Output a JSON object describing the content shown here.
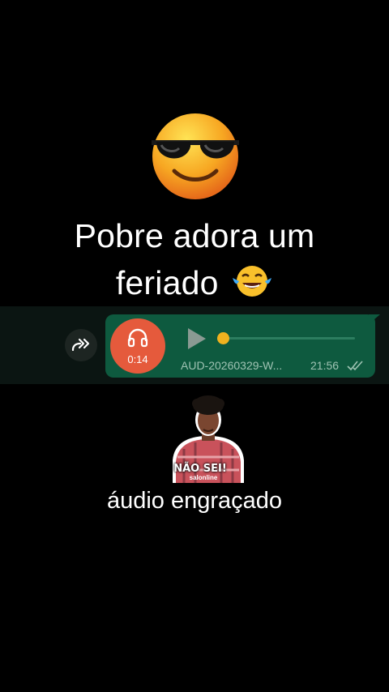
{
  "headline": {
    "line1": "Pobre adora um",
    "line2": "feriado"
  },
  "icons": {
    "top_emoji": "smiling-face-with-sunglasses-icon",
    "inline_emoji": "face-with-tears-of-joy-icon",
    "forward": "forward-icon",
    "headphones": "headphones-icon",
    "play": "play-icon",
    "read_receipt": "double-check-icon"
  },
  "voice_message": {
    "duration": "0:14",
    "filename": "AUD-20260329-W...",
    "time": "21:56",
    "progress": 0
  },
  "sticker": {
    "text": "NÃO SEI!",
    "brand": "salonline"
  },
  "caption": "áudio engraçado",
  "colors": {
    "background": "#000000",
    "bubble": "#0e5a3f",
    "avatar": "#e55a3c",
    "knob": "#f0b21f",
    "meta_text": "#9fc3b3"
  }
}
